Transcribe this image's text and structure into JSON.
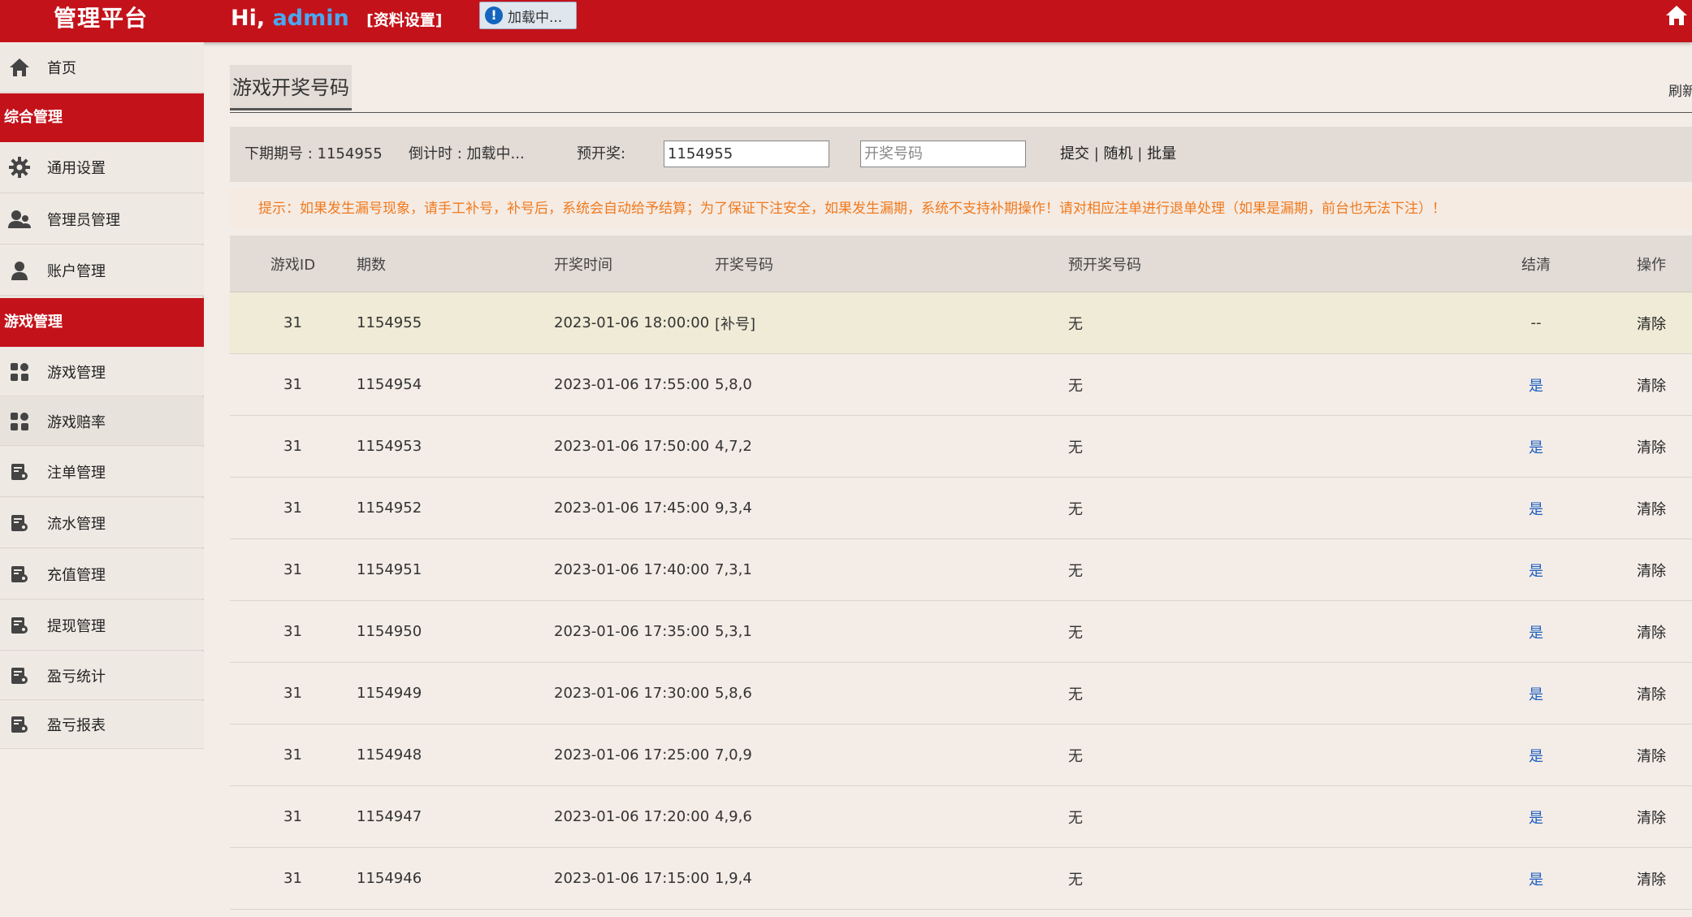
{
  "header": {
    "brand": "管理平台",
    "greeting_prefix": "Hi,",
    "username": "admin",
    "profile_link": "[资料设置]",
    "loading_text": "加载中..."
  },
  "sidebar": {
    "items": [
      {
        "label": "首页",
        "icon": "home-icon"
      },
      {
        "section": "综合管理"
      },
      {
        "label": "通用设置",
        "icon": "gear-icon"
      },
      {
        "label": "管理员管理",
        "icon": "users-icon"
      },
      {
        "label": "账户管理",
        "icon": "user-icon"
      },
      {
        "section": "游戏管理"
      },
      {
        "label": "游戏管理",
        "icon": "apps-icon"
      },
      {
        "label": "游戏赔率",
        "icon": "apps-icon"
      },
      {
        "label": "注单管理",
        "icon": "ledger-icon"
      },
      {
        "label": "流水管理",
        "icon": "ledger-icon"
      },
      {
        "label": "充值管理",
        "icon": "ledger-icon"
      },
      {
        "label": "提现管理",
        "icon": "ledger-icon"
      },
      {
        "label": "盈亏统计",
        "icon": "ledger-icon"
      },
      {
        "label": "盈亏报表",
        "icon": "ledger-icon"
      }
    ]
  },
  "main": {
    "page_title": "游戏开奖号码",
    "refresh_label": "刷新",
    "toolbar": {
      "next_period": "下期期号 : 1154955",
      "countdown": "倒计时 : 加载中...",
      "pre_label": "预开奖:",
      "pre_value": "1154955",
      "code_placeholder": "开奖号码",
      "submit": "提交",
      "random": "随机",
      "batch": "批量",
      "separator": "|"
    },
    "notice": "提示：如果发生漏号现象，请手工补号，补号后，系统会自动给予结算；为了保证下注安全，如果发生漏期，系统不支持补期操作！请对相应注单进行退单处理（如果是漏期，前台也无法下注）！",
    "table": {
      "headers": [
        "游戏ID",
        "期数",
        "开奖时间",
        "开奖号码",
        "预开奖号码",
        "结清",
        "操作"
      ],
      "rows": [
        {
          "id": "31",
          "period": "1154955",
          "time": "2023-01-06 18:00:00",
          "code": "[补号]",
          "pre": "无",
          "settle": "--",
          "op": "清除"
        },
        {
          "id": "31",
          "period": "1154954",
          "time": "2023-01-06 17:55:00",
          "code": "5,8,0",
          "pre": "无",
          "settle": "是",
          "op": "清除"
        },
        {
          "id": "31",
          "period": "1154953",
          "time": "2023-01-06 17:50:00",
          "code": "4,7,2",
          "pre": "无",
          "settle": "是",
          "op": "清除"
        },
        {
          "id": "31",
          "period": "1154952",
          "time": "2023-01-06 17:45:00",
          "code": "9,3,4",
          "pre": "无",
          "settle": "是",
          "op": "清除"
        },
        {
          "id": "31",
          "period": "1154951",
          "time": "2023-01-06 17:40:00",
          "code": "7,3,1",
          "pre": "无",
          "settle": "是",
          "op": "清除"
        },
        {
          "id": "31",
          "period": "1154950",
          "time": "2023-01-06 17:35:00",
          "code": "5,3,1",
          "pre": "无",
          "settle": "是",
          "op": "清除"
        },
        {
          "id": "31",
          "period": "1154949",
          "time": "2023-01-06 17:30:00",
          "code": "5,8,6",
          "pre": "无",
          "settle": "是",
          "op": "清除"
        },
        {
          "id": "31",
          "period": "1154948",
          "time": "2023-01-06 17:25:00",
          "code": "7,0,9",
          "pre": "无",
          "settle": "是",
          "op": "清除"
        },
        {
          "id": "31",
          "period": "1154947",
          "time": "2023-01-06 17:20:00",
          "code": "4,9,6",
          "pre": "无",
          "settle": "是",
          "op": "清除"
        },
        {
          "id": "31",
          "period": "1154946",
          "time": "2023-01-06 17:15:00",
          "code": "1,9,4",
          "pre": "无",
          "settle": "是",
          "op": "清除"
        }
      ]
    }
  },
  "colors": {
    "brand_red": "#c4121a",
    "username_blue": "#4aa7ef",
    "notice_orange": "#f07a1e",
    "settle_blue": "#1f5fbf",
    "highlight_row": "#efebd6"
  }
}
